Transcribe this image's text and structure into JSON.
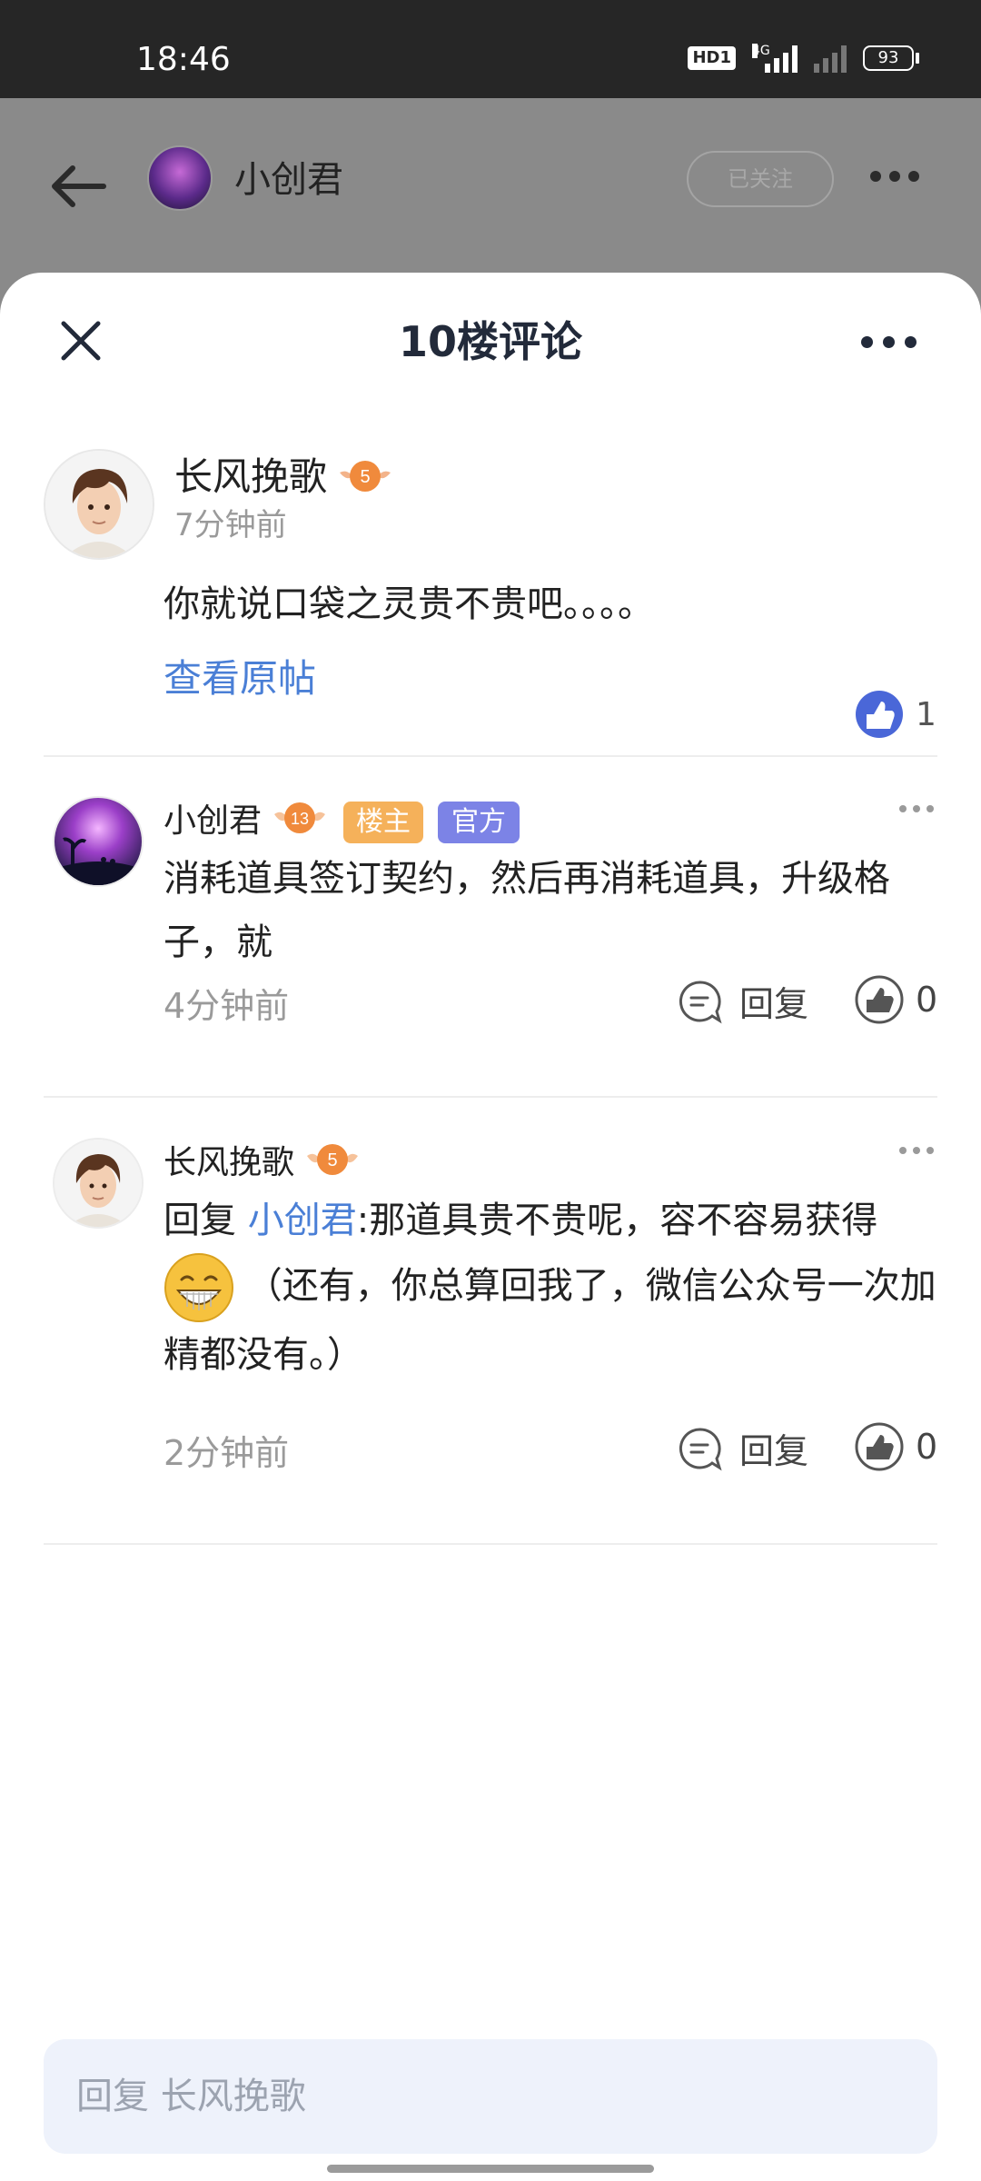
{
  "status_bar": {
    "time": "18:46",
    "hd_label": "HD1",
    "network_label": "4G",
    "battery_level": "93"
  },
  "background_header": {
    "title": "小创君",
    "follow_label": "已关注"
  },
  "sheet": {
    "title": "10楼评论"
  },
  "main_comment": {
    "author": "长风挽歌",
    "level": "5",
    "time": "7分钟前",
    "text": "你就说口袋之灵贵不贵吧。。。。",
    "view_original": "查看原帖",
    "likes": "1"
  },
  "replies": [
    {
      "author": "小创君",
      "level": "13",
      "tags": [
        "楼主",
        "官方"
      ],
      "text": "消耗道具签订契约，然后再消耗道具，升级格子，就",
      "time": "4分钟前",
      "reply_label": "回复",
      "likes": "0"
    },
    {
      "author": "长风挽歌",
      "level": "5",
      "prefix": "回复",
      "mention": "小创君",
      "text_line1": ":那道具贵不贵呢，容不容易获得",
      "text_after_emoji": "（还有，你总算回我了，微信公众号一次加精都没有。）",
      "emoji": "grinning-face",
      "time": "2分钟前",
      "reply_label": "回复",
      "likes": "0"
    }
  ],
  "reply_input": {
    "placeholder": "回复 长风挽歌"
  },
  "colors": {
    "accent_blue": "#4a7fd6",
    "tag_owner": "#f5b15a",
    "tag_official": "#7c83e6",
    "level_badge": "#f08a3c",
    "input_bg": "#eef2fb"
  }
}
